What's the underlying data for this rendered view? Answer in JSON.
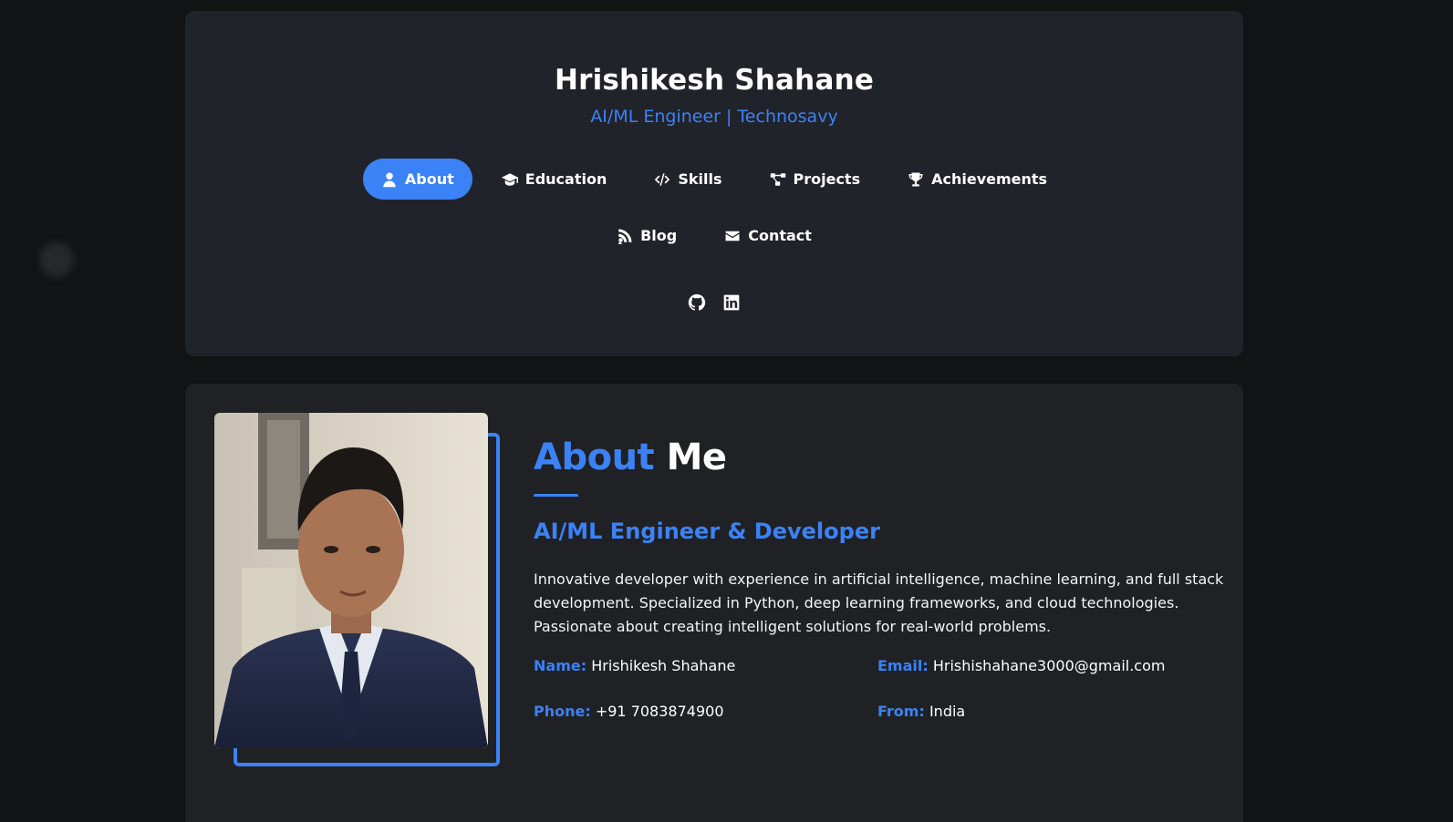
{
  "header": {
    "name": "Hrishikesh Shahane",
    "tagline": "AI/ML Engineer | Technosavy"
  },
  "nav": {
    "items": [
      {
        "label": "About",
        "icon": "user-icon",
        "active": true
      },
      {
        "label": "Education",
        "icon": "graduation-cap-icon",
        "active": false
      },
      {
        "label": "Skills",
        "icon": "code-icon",
        "active": false
      },
      {
        "label": "Projects",
        "icon": "project-diagram-icon",
        "active": false
      },
      {
        "label": "Achievements",
        "icon": "trophy-icon",
        "active": false
      },
      {
        "label": "Blog",
        "icon": "blog-icon",
        "active": false
      },
      {
        "label": "Contact",
        "icon": "envelope-icon",
        "active": false
      }
    ]
  },
  "socials": [
    {
      "icon": "github-icon"
    },
    {
      "icon": "linkedin-icon"
    }
  ],
  "about": {
    "heading_accent": "About",
    "heading_rest": "Me",
    "subtitle": "AI/ML Engineer & Developer",
    "bio": "Innovative developer with experience in artificial intelligence, machine learning, and full stack development. Specialized in Python, deep learning frameworks, and cloud technologies. Passionate about creating intelligent solutions for real-world problems.",
    "info": {
      "name_label": "Name:",
      "name_value": "Hrishikesh Shahane",
      "email_label": "Email:",
      "email_value": "Hrishishahane3000@gmail.com",
      "phone_label": "Phone:",
      "phone_value": "+91 7083874900",
      "from_label": "From:",
      "from_value": "India"
    }
  },
  "colors": {
    "accent": "#3b82f6",
    "background": "#121314",
    "card": "#21232a"
  }
}
